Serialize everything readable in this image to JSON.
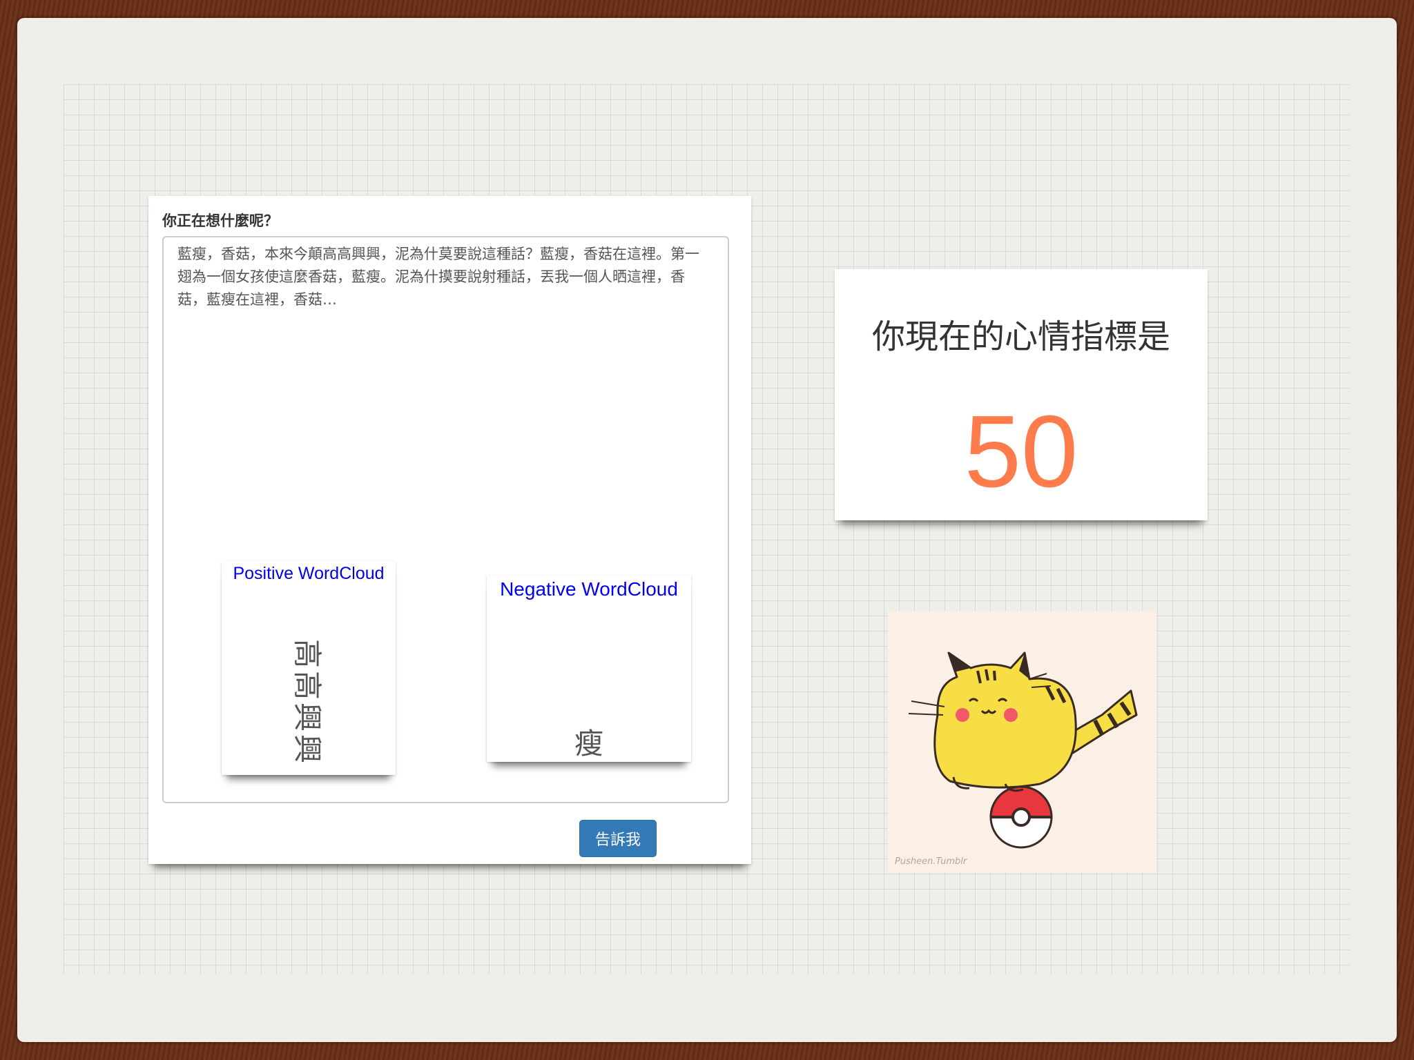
{
  "form": {
    "label": "你正在想什麼呢？",
    "post_text": "藍瘦，香菇，本來今顛高高興興，泥為什莫要說這種話？藍瘦，香菇在這裡。第一翅為一個女孩使這麼香菇，藍瘦。泥為什摸要說射種話，丟我一個人晒這裡，香菇，藍瘦在這裡，香菇…",
    "submit_label": "告訴我"
  },
  "wordclouds": {
    "positive": {
      "title": "Positive WordCloud",
      "word": "高高興興"
    },
    "negative": {
      "title": "Negative WordCloud",
      "word": "瘦"
    }
  },
  "score": {
    "title": "你現在的心情指標是",
    "value": "50",
    "value_color": "#ff7b4b"
  },
  "image": {
    "subject": "pusheen-pikachu-cat-on-pokeball",
    "credit": "Pusheen.Tumblr"
  },
  "colors": {
    "button": "#337ab7",
    "wordcloud_title": "#0000ee",
    "background_wood": "#6b2f16"
  }
}
